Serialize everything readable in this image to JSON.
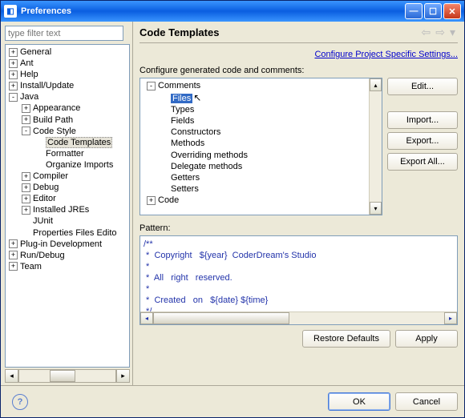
{
  "window": {
    "title": "Preferences"
  },
  "filter": {
    "placeholder": "type filter text"
  },
  "leftTree": [
    {
      "d": 0,
      "e": "+",
      "l": "General"
    },
    {
      "d": 0,
      "e": "+",
      "l": "Ant"
    },
    {
      "d": 0,
      "e": "+",
      "l": "Help"
    },
    {
      "d": 0,
      "e": "+",
      "l": "Install/Update"
    },
    {
      "d": 0,
      "e": "-",
      "l": "Java"
    },
    {
      "d": 1,
      "e": "+",
      "l": "Appearance"
    },
    {
      "d": 1,
      "e": "+",
      "l": "Build Path"
    },
    {
      "d": 1,
      "e": "-",
      "l": "Code Style"
    },
    {
      "d": 2,
      "e": "",
      "l": "Code Templates",
      "sel": true
    },
    {
      "d": 2,
      "e": "",
      "l": "Formatter"
    },
    {
      "d": 2,
      "e": "",
      "l": "Organize Imports"
    },
    {
      "d": 1,
      "e": "+",
      "l": "Compiler"
    },
    {
      "d": 1,
      "e": "+",
      "l": "Debug"
    },
    {
      "d": 1,
      "e": "+",
      "l": "Editor"
    },
    {
      "d": 1,
      "e": "+",
      "l": "Installed JREs"
    },
    {
      "d": 1,
      "e": "",
      "l": "JUnit"
    },
    {
      "d": 1,
      "e": "",
      "l": "Properties Files Edito"
    },
    {
      "d": 0,
      "e": "+",
      "l": "Plug-in Development"
    },
    {
      "d": 0,
      "e": "+",
      "l": "Run/Debug"
    },
    {
      "d": 0,
      "e": "+",
      "l": "Team"
    }
  ],
  "header": {
    "title": "Code Templates"
  },
  "link": "Configure Project Specific Settings...",
  "configLabel": "Configure generated code and comments:",
  "cfgTree": [
    {
      "d": 0,
      "e": "-",
      "l": "Comments"
    },
    {
      "d": 1,
      "e": "",
      "l": "Files",
      "sel": true,
      "cursor": true
    },
    {
      "d": 1,
      "e": "",
      "l": "Types"
    },
    {
      "d": 1,
      "e": "",
      "l": "Fields"
    },
    {
      "d": 1,
      "e": "",
      "l": "Constructors"
    },
    {
      "d": 1,
      "e": "",
      "l": "Methods"
    },
    {
      "d": 1,
      "e": "",
      "l": "Overriding methods"
    },
    {
      "d": 1,
      "e": "",
      "l": "Delegate methods"
    },
    {
      "d": 1,
      "e": "",
      "l": "Getters"
    },
    {
      "d": 1,
      "e": "",
      "l": "Setters"
    },
    {
      "d": 0,
      "e": "+",
      "l": "Code"
    }
  ],
  "buttons": {
    "edit": "Edit...",
    "import": "Import...",
    "export": "Export...",
    "exportAll": "Export All..."
  },
  "patternLabel": "Pattern:",
  "patternText": "/**\n *  Copyright   ${year}  CoderDream's Studio\n *\n *  All   right   reserved.\n *\n *  Created   on   ${date} ${time}\n */",
  "bottom": {
    "restore": "Restore Defaults",
    "apply": "Apply"
  },
  "footer": {
    "ok": "OK",
    "cancel": "Cancel"
  }
}
